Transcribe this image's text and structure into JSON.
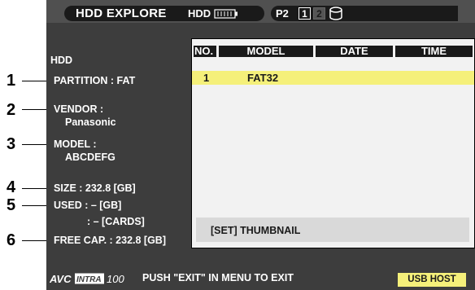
{
  "header": {
    "title": "HDD EXPLORE",
    "p2_label": "P2",
    "slot1": "1",
    "slot2": "2",
    "hdd_label": "HDD"
  },
  "info": {
    "heading": "HDD",
    "partition": "PARTITION : FAT",
    "vendor_label": "VENDOR :",
    "vendor_value": "Panasonic",
    "model_label": "MODEL :",
    "model_value": "ABCDEFG",
    "size": "SIZE : 232.8 [GB]",
    "used_gb": "USED : – [GB]",
    "used_cards": ": – [CARDS]",
    "free_cap": "FREE CAP. : 232.8 [GB]"
  },
  "table": {
    "columns": [
      "NO.",
      "MODEL",
      "DATE",
      "TIME"
    ],
    "rows": [
      {
        "no": "1",
        "model": "FAT32",
        "date": "",
        "time": ""
      }
    ]
  },
  "thumbnail_bar": "[SET] THUMBNAIL",
  "footer": {
    "logo_text": "AVC INTRA 100",
    "logo_a": "AVC",
    "logo_b": "INTRA",
    "logo_c": "100",
    "message": "PUSH \"EXIT\" IN MENU TO EXIT",
    "usb_button": "USB HOST"
  },
  "callouts": [
    "1",
    "2",
    "3",
    "4",
    "5",
    "6"
  ],
  "colors": {
    "screen_bg": "#3d3d3d",
    "selected_row": "#f5f07a",
    "header_cells": "#1a1a1a"
  }
}
